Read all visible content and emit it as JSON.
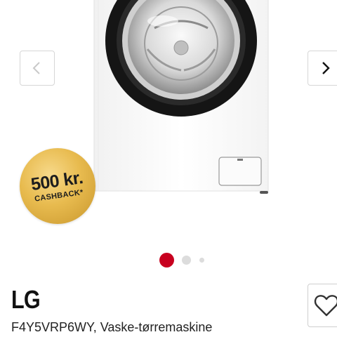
{
  "gallery": {
    "image_alt": "LG vaskemaskine",
    "prev_icon": "chevron-left-icon",
    "next_icon": "chevron-right-icon",
    "slide_count": 3,
    "active_slide": 1
  },
  "badge": {
    "amount": "500 kr.",
    "label": "CASHBACK*"
  },
  "product": {
    "brand": "LG",
    "name": "F4Y5VRP6WY, Vaske-tørremaskine",
    "favorite_icon": "heart-icon"
  },
  "colors": {
    "accent": "#c8001f",
    "badge_gold": "#e8bb4f"
  }
}
